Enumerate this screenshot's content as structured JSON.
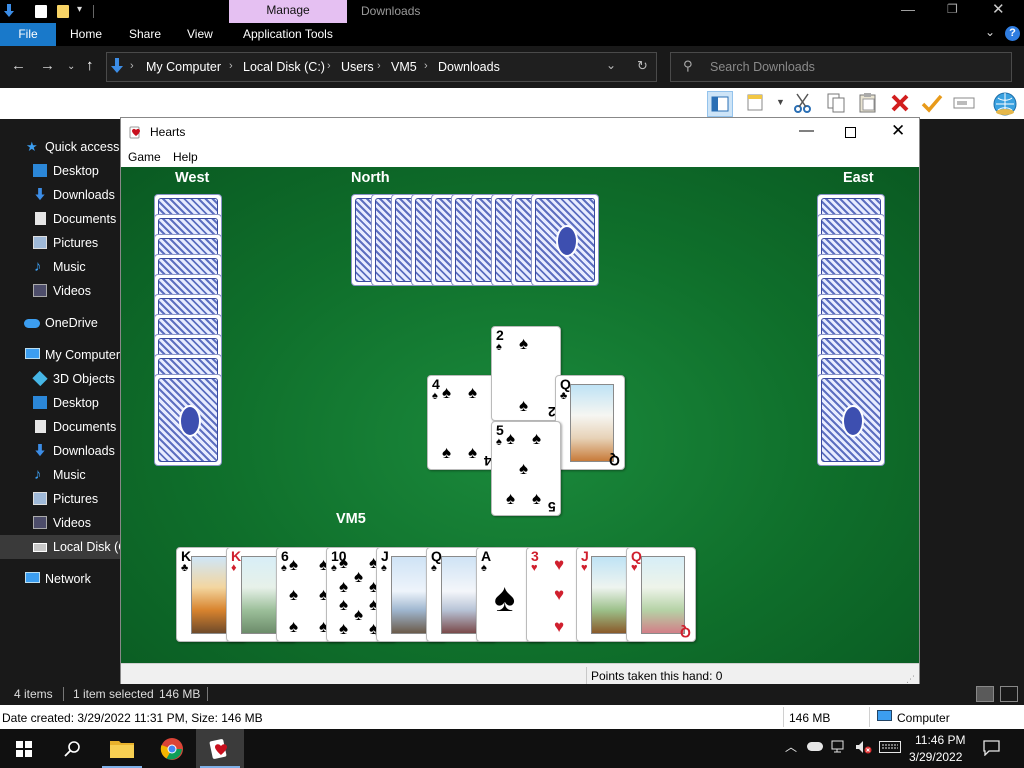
{
  "explorer": {
    "title": "Downloads",
    "context_tab": "Manage",
    "ribbon_tabs": [
      "File",
      "Home",
      "Share",
      "View",
      "Application Tools"
    ],
    "breadcrumb": [
      "My Computer",
      "Local Disk (C:)",
      "Users",
      "VM5",
      "Downloads"
    ],
    "search_placeholder": "Search Downloads",
    "nav": {
      "quick_access": "Quick access",
      "quick_items": [
        "Desktop",
        "Downloads",
        "Documents",
        "Pictures",
        "Music",
        "Videos"
      ],
      "onedrive": "OneDrive",
      "my_computer": "My Computer",
      "computer_items": [
        "3D Objects",
        "Desktop",
        "Documents",
        "Downloads",
        "Music",
        "Pictures",
        "Videos",
        "Local Disk (C"
      ],
      "network": "Network"
    },
    "status": {
      "items": "4 items",
      "selected": "1 item selected",
      "size": "146 MB"
    },
    "details": {
      "text": "Date created: 3/29/2022 11:31 PM, Size: 146 MB",
      "size": "146 MB",
      "location": "Computer"
    }
  },
  "hearts": {
    "title": "Hearts",
    "menu": [
      "Game",
      "Help"
    ],
    "players": {
      "west": "West",
      "north": "North",
      "east": "East",
      "south": "VM5"
    },
    "opponent_card_counts": {
      "west": 10,
      "north": 10,
      "east": 10
    },
    "trick": [
      {
        "player": "west",
        "rank": "4",
        "suit": "♠"
      },
      {
        "player": "north",
        "rank": "2",
        "suit": "♠"
      },
      {
        "player": "east",
        "rank": "Q",
        "suit": "♣"
      },
      {
        "player": "south",
        "rank": "5",
        "suit": "♠"
      }
    ],
    "hand": [
      {
        "rank": "K",
        "suit": "♣",
        "color": "black"
      },
      {
        "rank": "K",
        "suit": "♦",
        "color": "red"
      },
      {
        "rank": "6",
        "suit": "♠",
        "color": "black"
      },
      {
        "rank": "10",
        "suit": "♠",
        "color": "black"
      },
      {
        "rank": "J",
        "suit": "♠",
        "color": "black"
      },
      {
        "rank": "Q",
        "suit": "♠",
        "color": "black"
      },
      {
        "rank": "A",
        "suit": "♠",
        "color": "black"
      },
      {
        "rank": "3",
        "suit": "♥",
        "color": "red"
      },
      {
        "rank": "J",
        "suit": "♥",
        "color": "red"
      },
      {
        "rank": "Q",
        "suit": "♥",
        "color": "red"
      }
    ],
    "status": "Points taken this hand: 0"
  },
  "taskbar": {
    "time": "11:46 PM",
    "date": "3/29/2022"
  },
  "colors": {
    "felt": "#1b8a3c",
    "file_tab": "#1979ca",
    "context_tab": "#e5c0f2"
  }
}
